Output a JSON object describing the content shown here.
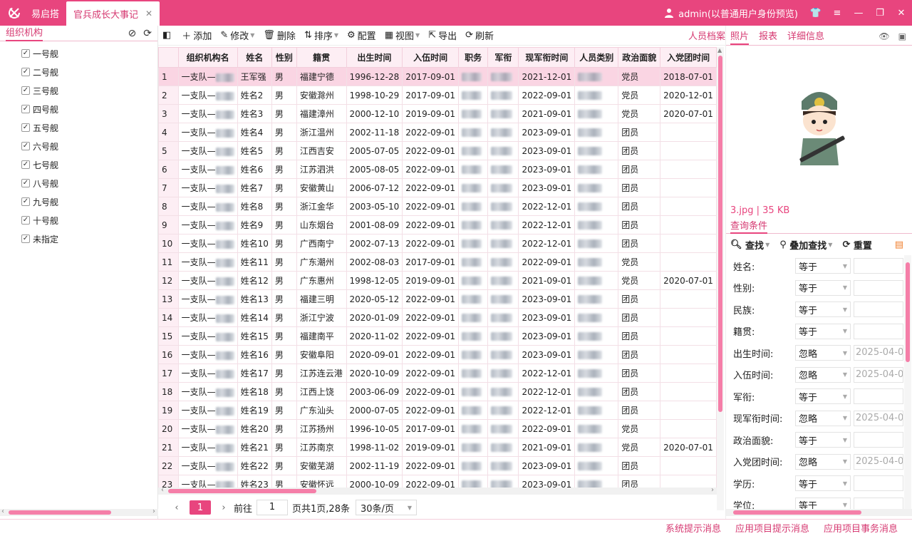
{
  "titlebar": {
    "app_name": "易启搭",
    "tab_title": "官兵成长大事记",
    "close_glyph": "✕",
    "user_label": "admin(以普通用户身份预览)"
  },
  "left": {
    "title": "组织机构",
    "items": [
      "一号舰",
      "二号舰",
      "三号舰",
      "四号舰",
      "五号舰",
      "六号舰",
      "七号舰",
      "八号舰",
      "九号舰",
      "十号舰",
      "未指定"
    ]
  },
  "toolbar": {
    "add": "添加",
    "edit": "修改",
    "delete": "删除",
    "sort": "排序",
    "config": "配置",
    "view": "视图",
    "export": "导出",
    "refresh": "刷新",
    "archive": "人员档案"
  },
  "table": {
    "columns": [
      "组织机构名",
      "姓名",
      "性别",
      "籍贯",
      "出生时间",
      "入伍时间",
      "职务",
      "军衔",
      "现军衔时间",
      "人员类别",
      "政治面貌",
      "入党团时间"
    ],
    "rows": [
      {
        "rn": "1",
        "org": "一支队—",
        "name": "王军强",
        "sex": "男",
        "origin": "福建宁德",
        "birth": "1996-12-28",
        "enlist": "2017-09-01",
        "rank_date": "2021-12-01",
        "politics": "党员",
        "party_date": "2018-07-01"
      },
      {
        "rn": "2",
        "org": "一支队—",
        "name": "姓名2",
        "sex": "男",
        "origin": "安徽滁州",
        "birth": "1998-10-29",
        "enlist": "2017-09-01",
        "rank_date": "2022-09-01",
        "politics": "党员",
        "party_date": "2020-12-01"
      },
      {
        "rn": "3",
        "org": "一支队—",
        "name": "姓名3",
        "sex": "男",
        "origin": "福建漳州",
        "birth": "2000-12-10",
        "enlist": "2019-09-01",
        "rank_date": "2021-09-01",
        "politics": "党员",
        "party_date": "2020-07-01"
      },
      {
        "rn": "4",
        "org": "一支队—",
        "name": "姓名4",
        "sex": "男",
        "origin": "浙江温州",
        "birth": "2002-11-18",
        "enlist": "2022-09-01",
        "rank_date": "2023-09-01",
        "politics": "团员",
        "party_date": ""
      },
      {
        "rn": "5",
        "org": "一支队—",
        "name": "姓名5",
        "sex": "男",
        "origin": "江西吉安",
        "birth": "2005-07-05",
        "enlist": "2022-09-01",
        "rank_date": "2023-09-01",
        "politics": "团员",
        "party_date": ""
      },
      {
        "rn": "6",
        "org": "一支队—",
        "name": "姓名6",
        "sex": "男",
        "origin": "江苏泗洪",
        "birth": "2005-08-05",
        "enlist": "2022-09-01",
        "rank_date": "2023-09-01",
        "politics": "团员",
        "party_date": ""
      },
      {
        "rn": "7",
        "org": "一支队—",
        "name": "姓名7",
        "sex": "男",
        "origin": "安徽黄山",
        "birth": "2006-07-12",
        "enlist": "2022-09-01",
        "rank_date": "2023-09-01",
        "politics": "团员",
        "party_date": ""
      },
      {
        "rn": "8",
        "org": "一支队—",
        "name": "姓名8",
        "sex": "男",
        "origin": "浙江金华",
        "birth": "2003-05-10",
        "enlist": "2022-09-01",
        "rank_date": "2022-12-01",
        "politics": "团员",
        "party_date": ""
      },
      {
        "rn": "9",
        "org": "一支队—",
        "name": "姓名9",
        "sex": "男",
        "origin": "山东烟台",
        "birth": "2001-08-09",
        "enlist": "2022-09-01",
        "rank_date": "2022-12-01",
        "politics": "团员",
        "party_date": ""
      },
      {
        "rn": "10",
        "org": "一支队—",
        "name": "姓名10",
        "sex": "男",
        "origin": "广西南宁",
        "birth": "2002-07-13",
        "enlist": "2022-09-01",
        "rank_date": "2022-12-01",
        "politics": "团员",
        "party_date": ""
      },
      {
        "rn": "11",
        "org": "一支队—",
        "name": "姓名11",
        "sex": "男",
        "origin": "广东潮州",
        "birth": "2002-08-03",
        "enlist": "2017-09-01",
        "rank_date": "2022-09-01",
        "politics": "党员",
        "party_date": ""
      },
      {
        "rn": "12",
        "org": "一支队—",
        "name": "姓名12",
        "sex": "男",
        "origin": "广东惠州",
        "birth": "1998-12-05",
        "enlist": "2019-09-01",
        "rank_date": "2021-09-01",
        "politics": "党员",
        "party_date": "2020-07-01"
      },
      {
        "rn": "13",
        "org": "一支队—",
        "name": "姓名13",
        "sex": "男",
        "origin": "福建三明",
        "birth": "2020-05-12",
        "enlist": "2022-09-01",
        "rank_date": "2023-09-01",
        "politics": "团员",
        "party_date": ""
      },
      {
        "rn": "14",
        "org": "一支队—",
        "name": "姓名14",
        "sex": "男",
        "origin": "浙江宁波",
        "birth": "2020-01-09",
        "enlist": "2022-09-01",
        "rank_date": "2023-09-01",
        "politics": "团员",
        "party_date": ""
      },
      {
        "rn": "15",
        "org": "一支队—",
        "name": "姓名15",
        "sex": "男",
        "origin": "福建南平",
        "birth": "2020-11-02",
        "enlist": "2022-09-01",
        "rank_date": "2023-09-01",
        "politics": "团员",
        "party_date": ""
      },
      {
        "rn": "16",
        "org": "一支队—",
        "name": "姓名16",
        "sex": "男",
        "origin": "安徽阜阳",
        "birth": "2020-09-01",
        "enlist": "2022-09-01",
        "rank_date": "2023-09-01",
        "politics": "团员",
        "party_date": ""
      },
      {
        "rn": "17",
        "org": "一支队—",
        "name": "姓名17",
        "sex": "男",
        "origin": "江苏连云港",
        "birth": "2020-10-09",
        "enlist": "2022-09-01",
        "rank_date": "2022-12-01",
        "politics": "团员",
        "party_date": ""
      },
      {
        "rn": "18",
        "org": "一支队—",
        "name": "姓名18",
        "sex": "男",
        "origin": "江西上饶",
        "birth": "2003-06-09",
        "enlist": "2022-09-01",
        "rank_date": "2022-12-01",
        "politics": "团员",
        "party_date": ""
      },
      {
        "rn": "19",
        "org": "一支队—",
        "name": "姓名19",
        "sex": "男",
        "origin": "广东汕头",
        "birth": "2000-07-05",
        "enlist": "2022-09-01",
        "rank_date": "2022-12-01",
        "politics": "团员",
        "party_date": ""
      },
      {
        "rn": "20",
        "org": "一支队—",
        "name": "姓名20",
        "sex": "男",
        "origin": "江苏扬州",
        "birth": "1996-10-05",
        "enlist": "2017-09-01",
        "rank_date": "2022-09-01",
        "politics": "党员",
        "party_date": ""
      },
      {
        "rn": "21",
        "org": "一支队—",
        "name": "姓名21",
        "sex": "男",
        "origin": "江苏南京",
        "birth": "1998-11-02",
        "enlist": "2019-09-01",
        "rank_date": "2021-09-01",
        "politics": "党员",
        "party_date": "2020-07-01"
      },
      {
        "rn": "22",
        "org": "一支队—",
        "name": "姓名22",
        "sex": "男",
        "origin": "安徽芜湖",
        "birth": "2002-11-19",
        "enlist": "2022-09-01",
        "rank_date": "2023-09-01",
        "politics": "团员",
        "party_date": ""
      },
      {
        "rn": "23",
        "org": "一支队—",
        "name": "姓名23",
        "sex": "男",
        "origin": "安徽怀远",
        "birth": "2000-10-09",
        "enlist": "2022-09-01",
        "rank_date": "2023-09-01",
        "politics": "团员",
        "party_date": ""
      }
    ]
  },
  "pager": {
    "current": "1",
    "goto_label": "前往",
    "goto_value": "1",
    "summary": "页共1页,28条",
    "page_size": "30条/页"
  },
  "right": {
    "tabs": [
      "照片",
      "报表",
      "详细信息"
    ],
    "file_info": "3.jpg | 35 KB",
    "query_title": "查询条件",
    "query_find": "查找",
    "query_add": "叠加查找",
    "query_reset": "重置",
    "fields": [
      {
        "label": "姓名:",
        "op": "等于",
        "val": ""
      },
      {
        "label": "性别:",
        "op": "等于",
        "val": ""
      },
      {
        "label": "民族:",
        "op": "等于",
        "val": ""
      },
      {
        "label": "籍贯:",
        "op": "等于",
        "val": ""
      },
      {
        "label": "出生时间:",
        "op": "忽略",
        "val": "2025-04-0"
      },
      {
        "label": "入伍时间:",
        "op": "忽略",
        "val": "2025-04-0"
      },
      {
        "label": "军衔:",
        "op": "等于",
        "val": ""
      },
      {
        "label": "现军衔时间:",
        "op": "忽略",
        "val": "2025-04-0"
      },
      {
        "label": "政治面貌:",
        "op": "等于",
        "val": ""
      },
      {
        "label": "入党团时间:",
        "op": "忽略",
        "val": "2025-04-0"
      },
      {
        "label": "学历:",
        "op": "等于",
        "val": ""
      },
      {
        "label": "学位:",
        "op": "等于",
        "val": ""
      }
    ]
  },
  "status": {
    "items": [
      "系统提示消息",
      "应用项目提示消息",
      "应用项目事务消息"
    ]
  },
  "colors": {
    "accent": "#e8457e",
    "selected_row": "#fad5e3",
    "header_bg": "#fdeef4"
  }
}
